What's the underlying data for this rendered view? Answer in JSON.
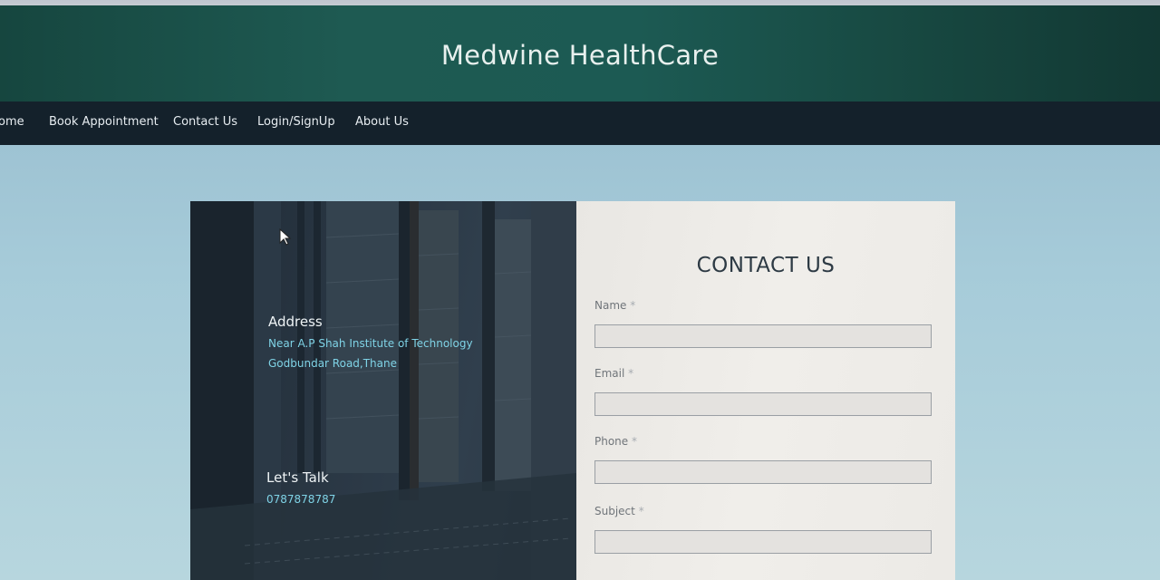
{
  "header": {
    "title": "Medwine HealthCare"
  },
  "nav": {
    "items": [
      {
        "label": "ome"
      },
      {
        "label": "Book Appointment"
      },
      {
        "label": "Contact Us"
      },
      {
        "label": "Login/SignUp"
      },
      {
        "label": "About Us"
      }
    ]
  },
  "info": {
    "address_heading": "Address",
    "address_line1": "Near A.P Shah Institute of Technology",
    "address_line2": "Godbundar Road,Thane",
    "talk_heading": "Let's Talk",
    "phone": "0787878787"
  },
  "form": {
    "title": "CONTACT US",
    "fields": [
      {
        "label": "Name",
        "value": ""
      },
      {
        "label": "Email",
        "value": ""
      },
      {
        "label": "Phone",
        "value": ""
      },
      {
        "label": "Subject",
        "value": ""
      }
    ],
    "required_marker": "*"
  },
  "colors": {
    "header_bg": "#1c5a53",
    "navbar_bg": "#14212b",
    "accent_text": "#7fd3e6"
  }
}
